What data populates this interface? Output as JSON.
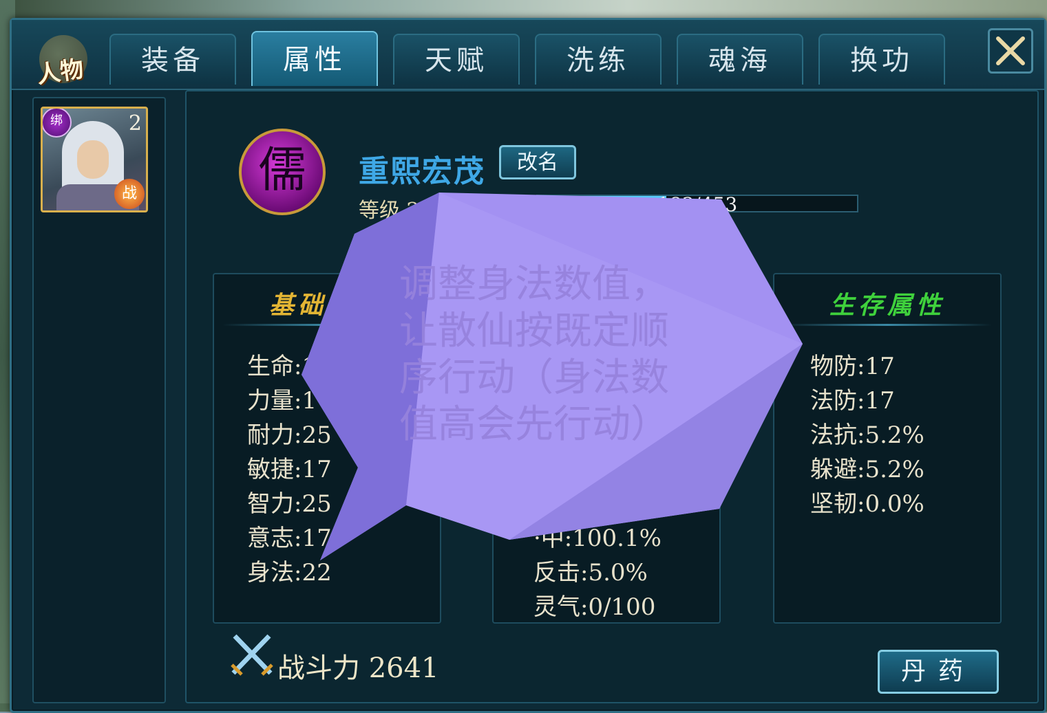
{
  "tabs": {
    "logo_label": "人物",
    "items": [
      "装备",
      "属性",
      "天赋",
      "洗练",
      "魂海",
      "换功"
    ],
    "active_index": 1
  },
  "character": {
    "portrait_badge": "绑",
    "portrait_level": "2",
    "battle_badge": "战",
    "class_emblem": "儒",
    "name": "重熙宏茂",
    "rename_label": "改名",
    "level_label": "等级 2",
    "exp_text": "183/453",
    "exp_fraction": 0.404
  },
  "base_attrs": {
    "title": "基础属性",
    "rows": [
      "生命:12",
      "力量:1",
      "耐力:25",
      "敏捷:17",
      "智力:25",
      "意志:17",
      "身法:22"
    ]
  },
  "mid_attrs": {
    "rows": [
      "·中:100.1%",
      "反击:5.0%",
      "灵气:0/100"
    ]
  },
  "survival_attrs": {
    "title": "生存属性",
    "rows": [
      "物防:17",
      "法防:17",
      "法抗:5.2%",
      "躲避:5.2%",
      "坚韧:0.0%"
    ]
  },
  "power": {
    "label": "战斗力 2641"
  },
  "pill_button": {
    "label": "丹药"
  },
  "tip": {
    "text": "调整身法数值，让散仙按既定顺序行动（身法数值高会先行动）"
  },
  "colors": {
    "base_title": "#e3b534",
    "survival_title": "#3fd13c",
    "bubble_fill": "#a391f2",
    "accent_blue": "#3fa8e6"
  }
}
